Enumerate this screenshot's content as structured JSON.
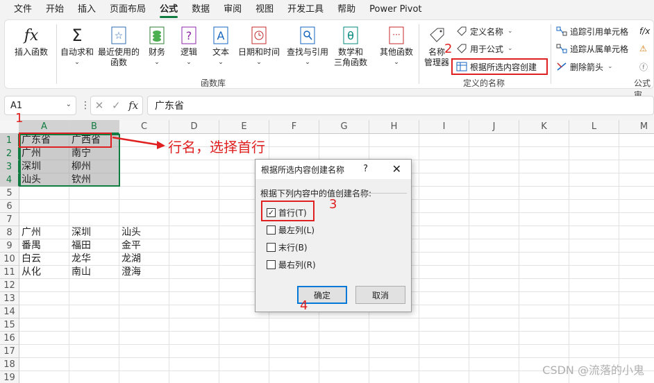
{
  "menu": [
    "文件",
    "开始",
    "插入",
    "页面布局",
    "公式",
    "数据",
    "审阅",
    "视图",
    "开发工具",
    "帮助",
    "Power Pivot"
  ],
  "ribbon": {
    "insert_function": "插入函数",
    "autosum": "自动求和",
    "recent": "最近使用的",
    "recent2": "函数",
    "financial": "财务",
    "logical": "逻辑",
    "text": "文本",
    "datetime": "日期和时间",
    "lookup": "查找与引用",
    "math1": "数学和",
    "math2": "三角函数",
    "other": "其他函数",
    "library_label": "函数库",
    "name_manager1": "名称",
    "name_manager2": "管理器",
    "define_name": "定义名称",
    "use_in_formula": "用于公式",
    "create_from_sel": "根据所选内容创建",
    "defined_names_label": "定义的名称",
    "trace_precedents": "追踪引用单元格",
    "trace_dependents": "追踪从属单元格",
    "remove_arrows": "删除箭头",
    "formula_audit_label": "公式审"
  },
  "formula_bar": {
    "namebox": "A1",
    "fx": "fx",
    "content": "广东省"
  },
  "grid": {
    "columns": [
      "A",
      "B",
      "C",
      "D",
      "E",
      "F",
      "G",
      "H",
      "I",
      "J",
      "K",
      "L",
      "M"
    ],
    "rows": [
      "1",
      "2",
      "3",
      "4",
      "5",
      "6",
      "7",
      "8",
      "9",
      "10",
      "11",
      "12",
      "13",
      "14",
      "15",
      "16",
      "17",
      "18",
      "19"
    ],
    "cells": {
      "A1": "广东省",
      "B1": "广西省",
      "A2": "广州",
      "B2": "南宁",
      "A3": "深圳",
      "B3": "柳州",
      "A4": "汕头",
      "B4": "钦州",
      "A8": "广州",
      "B8": "深圳",
      "C8": "汕头",
      "A9": "番禺",
      "B9": "福田",
      "C9": "金平",
      "A10": "白云",
      "B10": "龙华",
      "C10": "龙湖",
      "A11": "从化",
      "B11": "南山",
      "C11": "澄海"
    }
  },
  "annotations": {
    "step1": "1",
    "step2": "2",
    "step3": "3",
    "step4": "4",
    "arrow_text": "行名，选择首行"
  },
  "dialog": {
    "title": "根据所选内容创建名称",
    "help": "?",
    "close": "✕",
    "prompt": "根据下列内容中的值创建名称:",
    "options": [
      {
        "label": "首行(T)",
        "checked": true
      },
      {
        "label": "最左列(L)",
        "checked": false
      },
      {
        "label": "末行(B)",
        "checked": false
      },
      {
        "label": "最右列(R)",
        "checked": false
      }
    ],
    "ok": "确定",
    "cancel": "取消"
  },
  "watermark": "CSDN @流落的小鬼",
  "colors": {
    "accent": "#107c41",
    "annotation": "#e02020",
    "dialog_focus": "#0078d7"
  }
}
